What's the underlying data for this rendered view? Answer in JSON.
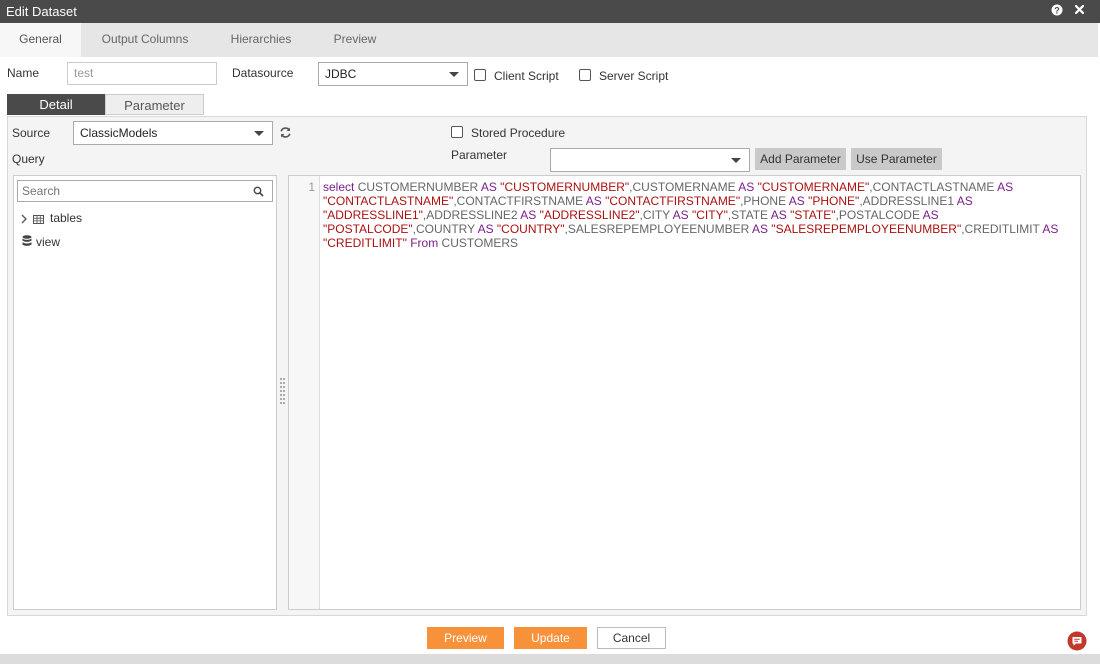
{
  "window": {
    "title": "Edit Dataset"
  },
  "tabs": [
    {
      "label": "General",
      "active": true
    },
    {
      "label": "Output Columns",
      "active": false
    },
    {
      "label": "Hierarchies",
      "active": false
    },
    {
      "label": "Preview",
      "active": false
    }
  ],
  "form": {
    "name_label": "Name",
    "name_value": "test",
    "datasource_label": "Datasource",
    "datasource_value": "JDBC",
    "client_script_label": "Client Script",
    "server_script_label": "Server Script"
  },
  "subtabs": [
    {
      "label": "Detail",
      "active": true
    },
    {
      "label": "Parameter",
      "active": false
    }
  ],
  "detail": {
    "source_label": "Source",
    "source_value": "ClassicModels",
    "query_label": "Query",
    "stored_procedure_label": "Stored Procedure",
    "parameter_label": "Parameter",
    "parameter_value": "",
    "add_parameter_label": "Add Parameter",
    "use_parameter_label": "Use Parameter"
  },
  "tree": {
    "search_placeholder": "Search",
    "items": [
      {
        "label": "tables",
        "icon": "table-icon"
      },
      {
        "label": "view",
        "icon": "database-icon"
      }
    ]
  },
  "editor": {
    "line_number": "1",
    "tokens": [
      {
        "t": "select",
        "c": "kw"
      },
      {
        "t": " CUSTOMERNUMBER ",
        "c": "p"
      },
      {
        "t": "AS",
        "c": "kw"
      },
      {
        "t": " \"CUSTOMERNUMBER\"",
        "c": "str"
      },
      {
        "t": ",CUSTOMERNAME ",
        "c": "p"
      },
      {
        "t": "AS",
        "c": "kw"
      },
      {
        "t": " \"CUSTOMERNAME\"",
        "c": "str"
      },
      {
        "t": ",CONTACTLASTNAME ",
        "c": "p"
      },
      {
        "t": "AS",
        "c": "kw"
      },
      {
        "t": " \"CONTACTLASTNAME\"",
        "c": "str"
      },
      {
        "t": ",CONTACTFIRSTNAME ",
        "c": "p"
      },
      {
        "t": "AS",
        "c": "kw"
      },
      {
        "t": " \"CONTACTFIRSTNAME\"",
        "c": "str"
      },
      {
        "t": ",PHONE ",
        "c": "p"
      },
      {
        "t": "AS",
        "c": "kw"
      },
      {
        "t": " \"PHONE\"",
        "c": "str"
      },
      {
        "t": ",ADDRESSLINE1 ",
        "c": "p"
      },
      {
        "t": "AS",
        "c": "kw"
      },
      {
        "t": " \"ADDRESSLINE1\"",
        "c": "str"
      },
      {
        "t": ",ADDRESSLINE2 ",
        "c": "p"
      },
      {
        "t": "AS",
        "c": "kw"
      },
      {
        "t": " \"ADDRESSLINE2\"",
        "c": "str"
      },
      {
        "t": ",CITY ",
        "c": "p"
      },
      {
        "t": "AS",
        "c": "kw"
      },
      {
        "t": " \"CITY\"",
        "c": "str"
      },
      {
        "t": ",STATE ",
        "c": "p"
      },
      {
        "t": "AS",
        "c": "kw"
      },
      {
        "t": " \"STATE\"",
        "c": "str"
      },
      {
        "t": ",POSTALCODE ",
        "c": "p"
      },
      {
        "t": "AS",
        "c": "kw"
      },
      {
        "t": " \"POSTALCODE\"",
        "c": "str"
      },
      {
        "t": ",COUNTRY ",
        "c": "p"
      },
      {
        "t": "AS",
        "c": "kw"
      },
      {
        "t": " \"COUNTRY\"",
        "c": "str"
      },
      {
        "t": ",SALESREPEMPLOYEENUMBER ",
        "c": "p"
      },
      {
        "t": "AS",
        "c": "kw"
      },
      {
        "t": " \"SALESREPEMPLOYEENUMBER\"",
        "c": "str"
      },
      {
        "t": ",CREDITLIMIT ",
        "c": "p"
      },
      {
        "t": "AS",
        "c": "kw"
      },
      {
        "t": " \"CREDITLIMIT\"",
        "c": "str"
      },
      {
        "t": " ",
        "c": "p"
      },
      {
        "t": "From",
        "c": "kw"
      },
      {
        "t": " CUSTOMERS",
        "c": "p"
      }
    ]
  },
  "footer": {
    "preview_label": "Preview",
    "update_label": "Update",
    "cancel_label": "Cancel"
  },
  "colors": {
    "accent": "#f7923a",
    "titlebar": "#4a4a4a",
    "keyword": "#7a1f8a",
    "string": "#aa1111"
  }
}
